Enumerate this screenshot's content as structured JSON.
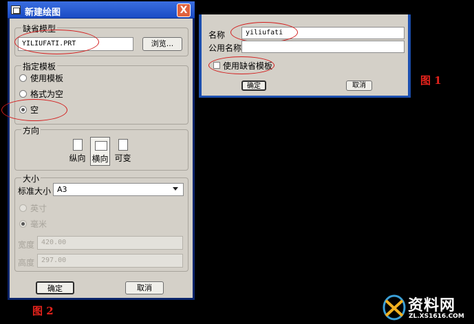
{
  "dialog": {
    "title": "新建绘图",
    "close_label": "X",
    "default_model": {
      "group_label": "缺省模型",
      "value": "YILIUFATI.PRT",
      "browse_label": "浏览..."
    },
    "template": {
      "group_label": "指定模板",
      "options": [
        "使用模板",
        "格式为空",
        "空"
      ],
      "selected": "空"
    },
    "orientation": {
      "group_label": "方向",
      "options": [
        "纵向",
        "横向",
        "可变"
      ],
      "selected": "横向"
    },
    "size": {
      "group_label": "大小",
      "standard_size_label": "标准大小",
      "standard_size_value": "A3",
      "units": [
        "英寸",
        "毫米"
      ],
      "selected_unit": "毫米",
      "width_label": "宽度",
      "width_value": "420.00",
      "height_label": "高度",
      "height_value": "297.00"
    },
    "ok_label": "确定",
    "cancel_label": "取消"
  },
  "figure1": {
    "name_label": "名称",
    "name_value": "yiliufati",
    "common_name_label": "公用名称",
    "common_name_value": "",
    "use_default_template_label": "使用缺省模板",
    "use_default_template_checked": false,
    "ok_label": "确定",
    "cancel_label": "取消"
  },
  "labels": {
    "figure1": "图 1",
    "figure2": "图 2"
  },
  "watermark": {
    "brand": "资料网",
    "url": "ZL.XS1616.COM"
  },
  "colors": {
    "annotation_red": "#d31c1c",
    "title_bar": "#2a5bd7",
    "dialog_bg": "#d4d0c8"
  }
}
